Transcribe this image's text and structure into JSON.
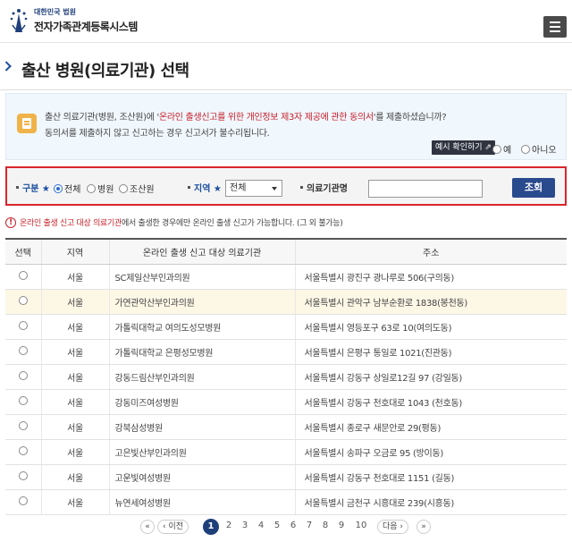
{
  "header": {
    "org_name": "대한민국 법원",
    "system_name": "전자가족관계등록시스템"
  },
  "page": {
    "title": "출산 병원(의료기관) 선택"
  },
  "consent": {
    "line1_before": "출산 의료기관(병원, 조산원)에 '",
    "line1_highlight": "온라인 출생신고를 위한 개인정보 제3자 제공에 관한 동의서",
    "line1_after": "'를 제출하셨습니까?",
    "line2": "동의서를 제출하지 않고 신고하는 경우 신고서가 불수리됩니다.",
    "example_button": "예시 확인하기",
    "options": [
      "예",
      "아니오"
    ]
  },
  "search": {
    "type_label": "구분",
    "type_options": [
      "전체",
      "병원",
      "조산원"
    ],
    "type_selected": "전체",
    "region_label": "지역",
    "region_value": "전체",
    "name_label": "의료기관명",
    "name_value": "",
    "search_button": "조회",
    "required_mark": "★"
  },
  "notice": {
    "highlight": "온라인 출생 신고 대상 의료기관",
    "rest": "에서 출생한 경우에만 온라인 출생 신고가 가능합니다. (그 외 불가능)"
  },
  "table": {
    "headers": [
      "선택",
      "지역",
      "온라인 출생 신고 대상 의료기관",
      "주소"
    ],
    "rows": [
      {
        "region": "서울",
        "name": "SC제일산부인과의원",
        "address": "서울특별시 광진구 광나루로 506(구의동)"
      },
      {
        "region": "서울",
        "name": "가연관악산부인과의원",
        "address": "서울특별시 관악구 남부순환로 1838(봉천동)"
      },
      {
        "region": "서울",
        "name": "가톨릭대학교 여의도성모병원",
        "address": "서울특별시 영등포구 63로 10(여의도동)"
      },
      {
        "region": "서울",
        "name": "가톨릭대학교 은평성모병원",
        "address": "서울특별시 은평구 통일로 1021(진관동)"
      },
      {
        "region": "서울",
        "name": "강동드림산부인과의원",
        "address": "서울특별시 강동구 상일로12길 97 (강일동)"
      },
      {
        "region": "서울",
        "name": "강동미즈여성병원",
        "address": "서울특별시 강동구 천호대로 1043 (천호동)"
      },
      {
        "region": "서울",
        "name": "강북삼성병원",
        "address": "서울특별시 종로구 새문안로 29(평동)"
      },
      {
        "region": "서울",
        "name": "고은빛산부인과의원",
        "address": "서울특별시 송파구 오금로 95 (방이동)"
      },
      {
        "region": "서울",
        "name": "고운빛여성병원",
        "address": "서울특별시 강동구 천호대로 1151 (길동)"
      },
      {
        "region": "서울",
        "name": "뉴연세여성병원",
        "address": "서울특별시 금천구 시흥대로 239(시흥동)"
      }
    ]
  },
  "pagination": {
    "prev_label": "이전",
    "next_label": "다음",
    "pages": [
      "1",
      "2",
      "3",
      "4",
      "5",
      "6",
      "7",
      "8",
      "9",
      "10"
    ],
    "current": "1",
    "first_icon": "double-chevron-left-icon",
    "last_icon": "double-chevron-right-icon"
  }
}
